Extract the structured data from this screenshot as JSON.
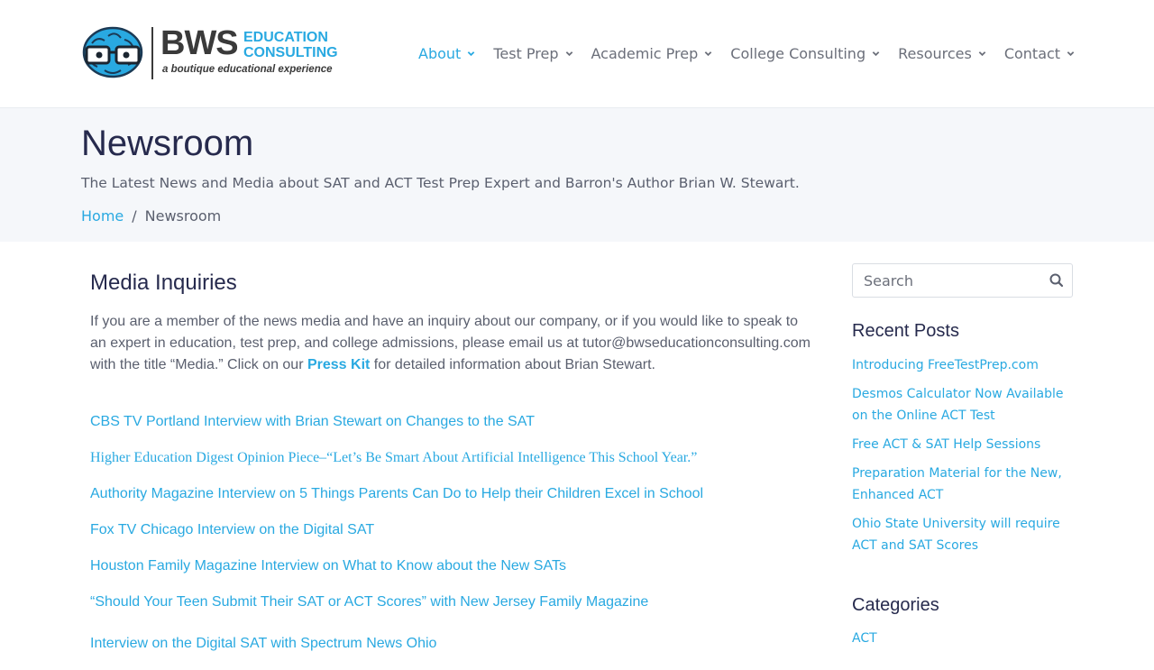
{
  "header": {
    "logo": {
      "wordmark": "BWS",
      "line1": "EDUCATION",
      "line2": "CONSULTING",
      "tagline": "a boutique educational experience"
    },
    "nav": [
      {
        "label": "About",
        "active": true
      },
      {
        "label": "Test Prep",
        "active": false
      },
      {
        "label": "Academic Prep",
        "active": false
      },
      {
        "label": "College Consulting",
        "active": false
      },
      {
        "label": "Resources",
        "active": false
      },
      {
        "label": "Contact",
        "active": false
      }
    ]
  },
  "page": {
    "title": "Newsroom",
    "subtitle": "The Latest News and Media about SAT and ACT Test Prep Expert and Barron's Author Brian W. Stewart.",
    "breadcrumb": {
      "home": "Home",
      "separator": "/",
      "current": "Newsroom"
    }
  },
  "main": {
    "heading": "Media Inquiries",
    "intro_before": "If you are a member of the news media and have an inquiry about our company, or if you would like to speak to an expert in education, test prep, and college admissions, please email us at tutor@bwseducationconsulting.com with the title “Media.”  Click on our ",
    "intro_link": "Press Kit",
    "intro_after": " for detailed information about Brian Stewart.",
    "links": [
      "CBS TV Portland Interview with Brian Stewart on Changes to the SAT",
      "Higher Education Digest Opinion Piece–“Let’s Be Smart About Artificial Intelligence This School Year.”",
      "Authority Magazine Interview on 5 Things Parents Can Do to Help their Children Excel in School",
      "Fox TV Chicago Interview on the Digital SAT",
      "Houston Family Magazine Interview on What to Know about the New SATs",
      "“Should Your Teen Submit Their SAT or ACT Scores” with New Jersey Family Magazine",
      "Interview on the Digital SAT with Spectrum News Ohio"
    ]
  },
  "sidebar": {
    "search_placeholder": "Search",
    "recent_heading": "Recent Posts",
    "recent_posts": [
      "Introducing FreeTestPrep.com",
      "Desmos Calculator Now Available on the Online ACT Test",
      "Free ACT & SAT Help Sessions",
      "Preparation Material for the New, Enhanced ACT",
      "Ohio State University will require ACT and SAT Scores"
    ],
    "categories_heading": "Categories",
    "categories": [
      "ACT"
    ]
  },
  "colors": {
    "accent": "#29a9e1",
    "heading": "#262a4d",
    "text": "#5a5f6e",
    "band": "#f5f7fa"
  },
  "icons": {
    "search": "search-icon",
    "caret": "chevron-down-icon",
    "logo": "brain-with-glasses-icon"
  }
}
